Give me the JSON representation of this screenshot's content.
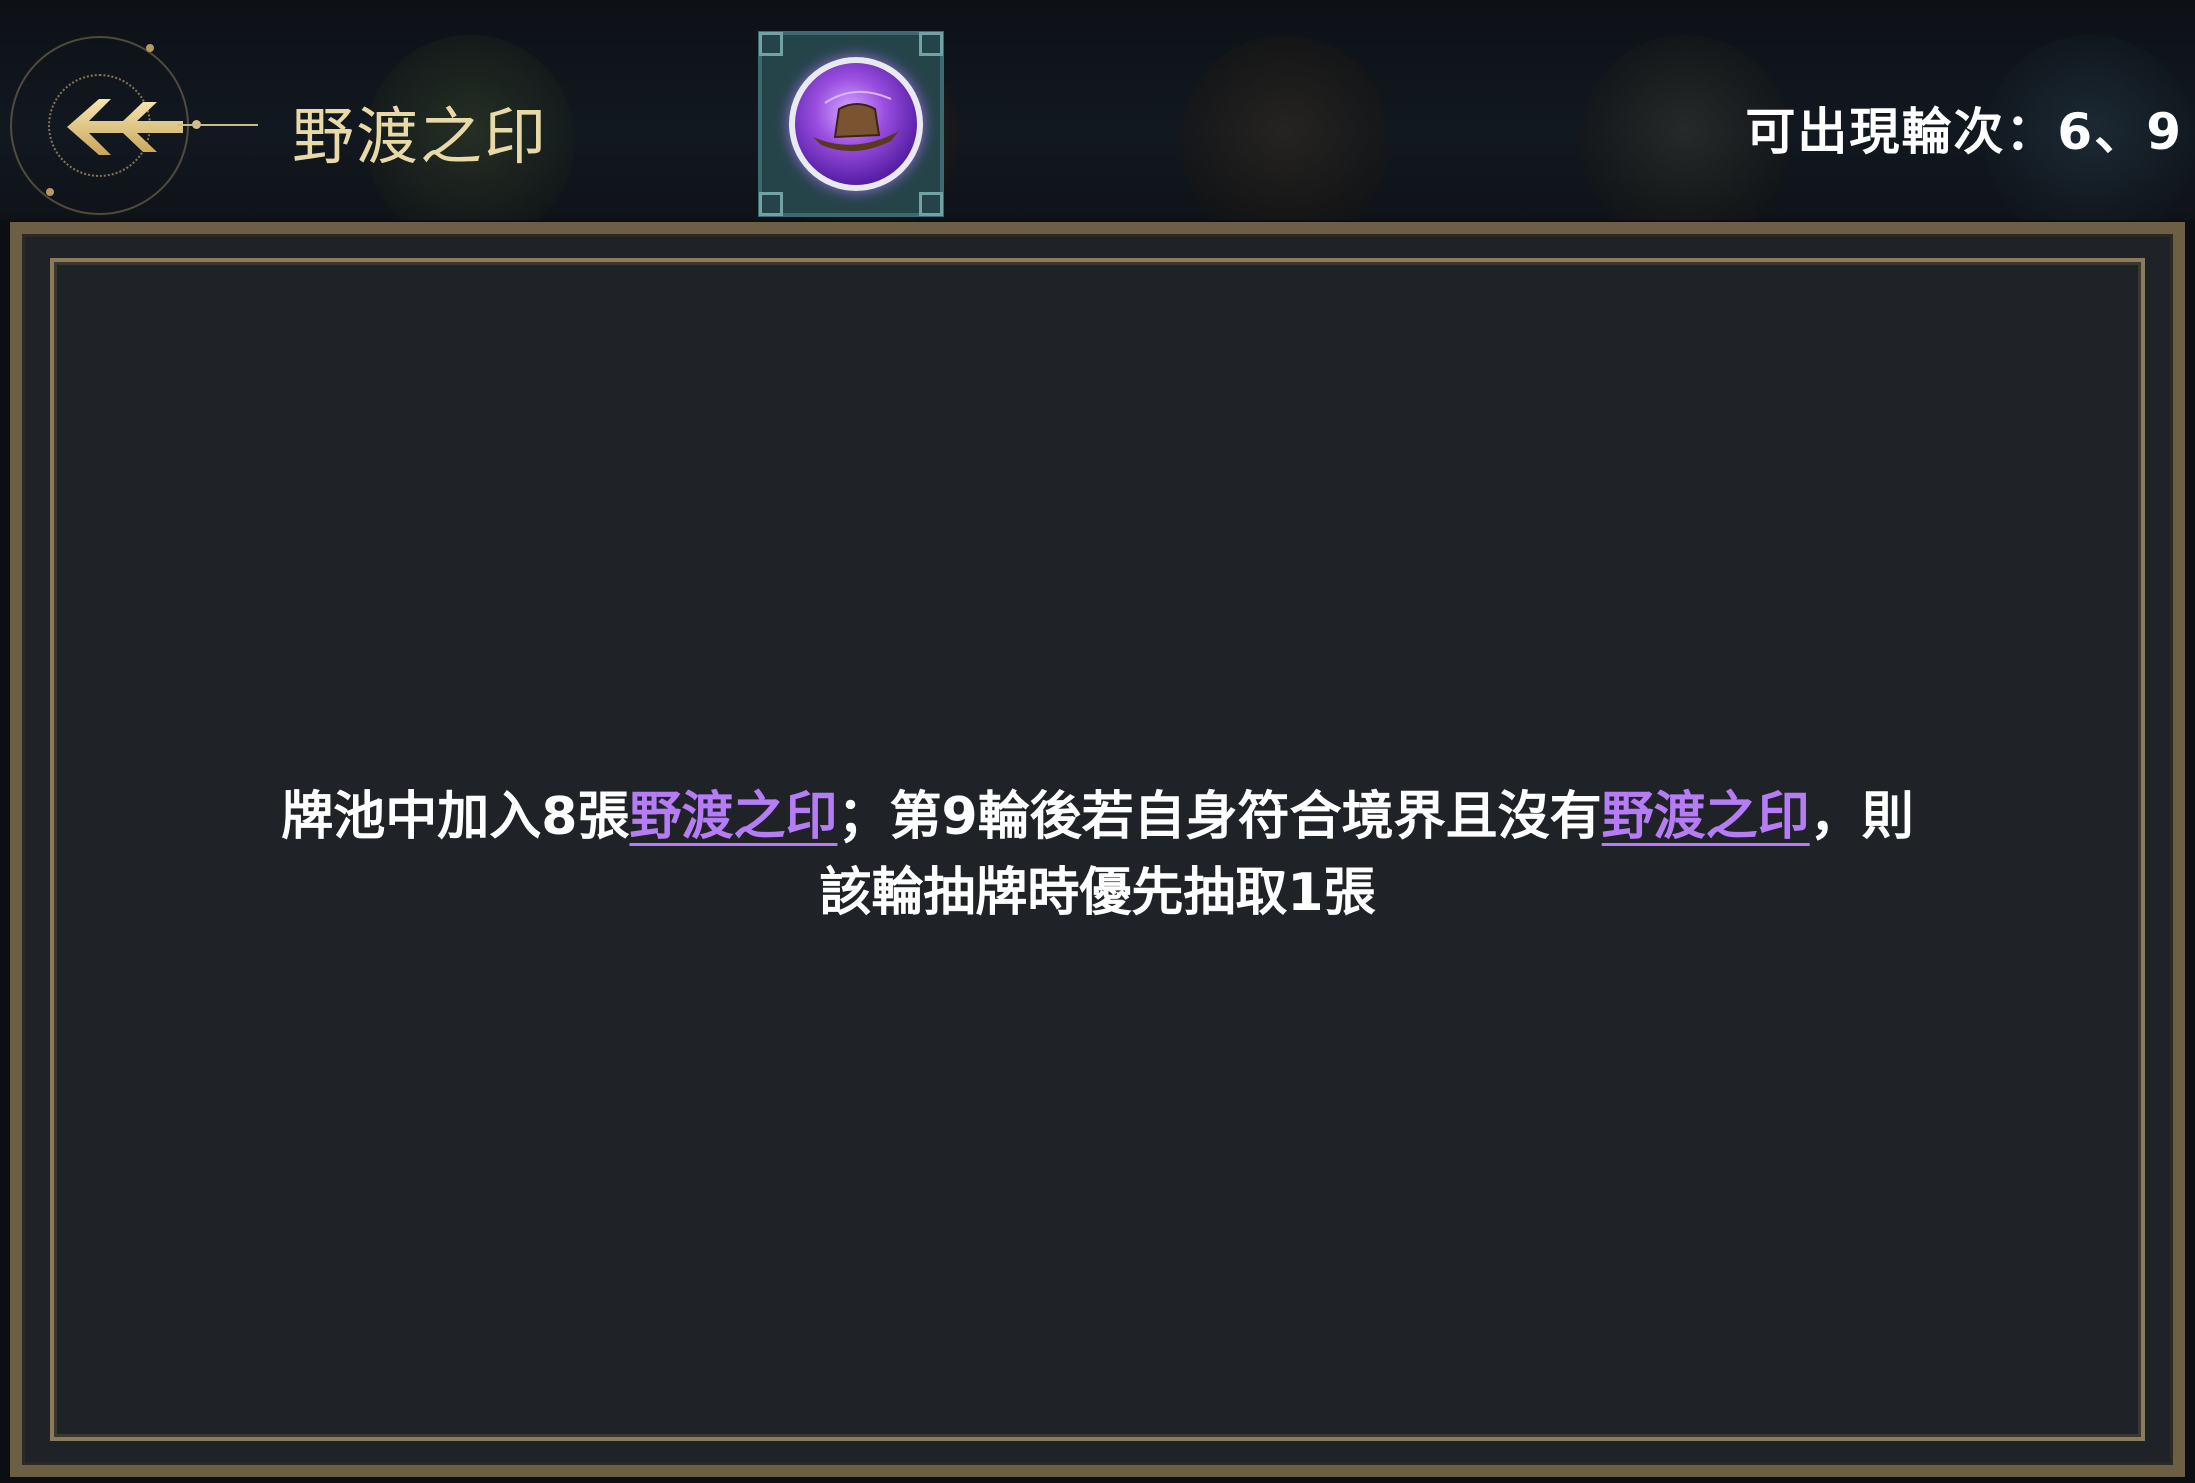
{
  "header": {
    "title": "野渡之印",
    "rounds_label": "可出現輪次：6、9"
  },
  "description": {
    "line1_part1": "牌池中加入8張",
    "line1_link1": "野渡之印",
    "line1_part2": "；第9輪後若自身符合境界且沒有",
    "line1_link2": "野渡之印",
    "line1_part3": "，則",
    "line2": "該輪抽牌時優先抽取1張"
  },
  "colors": {
    "title_gold": "#e8d9a6",
    "highlight_purple": "#b57cf5",
    "panel_bg": "#1f2327",
    "frame_gold": "#8a7b5b"
  },
  "icons": {
    "back": "back-arrow-icon",
    "seal": "seal-orb-icon"
  }
}
